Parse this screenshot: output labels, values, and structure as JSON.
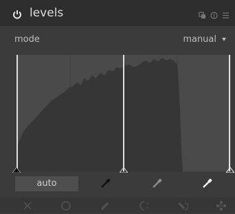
{
  "header": {
    "title": "levels",
    "icons": [
      "power-icon",
      "multi-instance-icon",
      "reset-icon",
      "presets-icon"
    ]
  },
  "mode": {
    "label": "mode",
    "value": "manual"
  },
  "levels": {
    "black_point": 0.0,
    "gray_point": 0.5,
    "white_point": 1.0
  },
  "buttons": {
    "auto_label": "auto"
  },
  "pickers": [
    "black-picker-icon",
    "gray-picker-icon",
    "white-picker-icon"
  ],
  "mask_tools": [
    "off-icon",
    "uniform-icon",
    "drawn-icon",
    "parametric-icon",
    "drawn-parametric-icon",
    "raster-icon"
  ],
  "colors": {
    "header_bg": "#2d2d2d",
    "panel_bg": "#3b3b3b",
    "graph_bg": "#4a4a4a",
    "histogram": "#363636",
    "marker": "#cfcfcf",
    "toolbar_bg": "#363636"
  }
}
